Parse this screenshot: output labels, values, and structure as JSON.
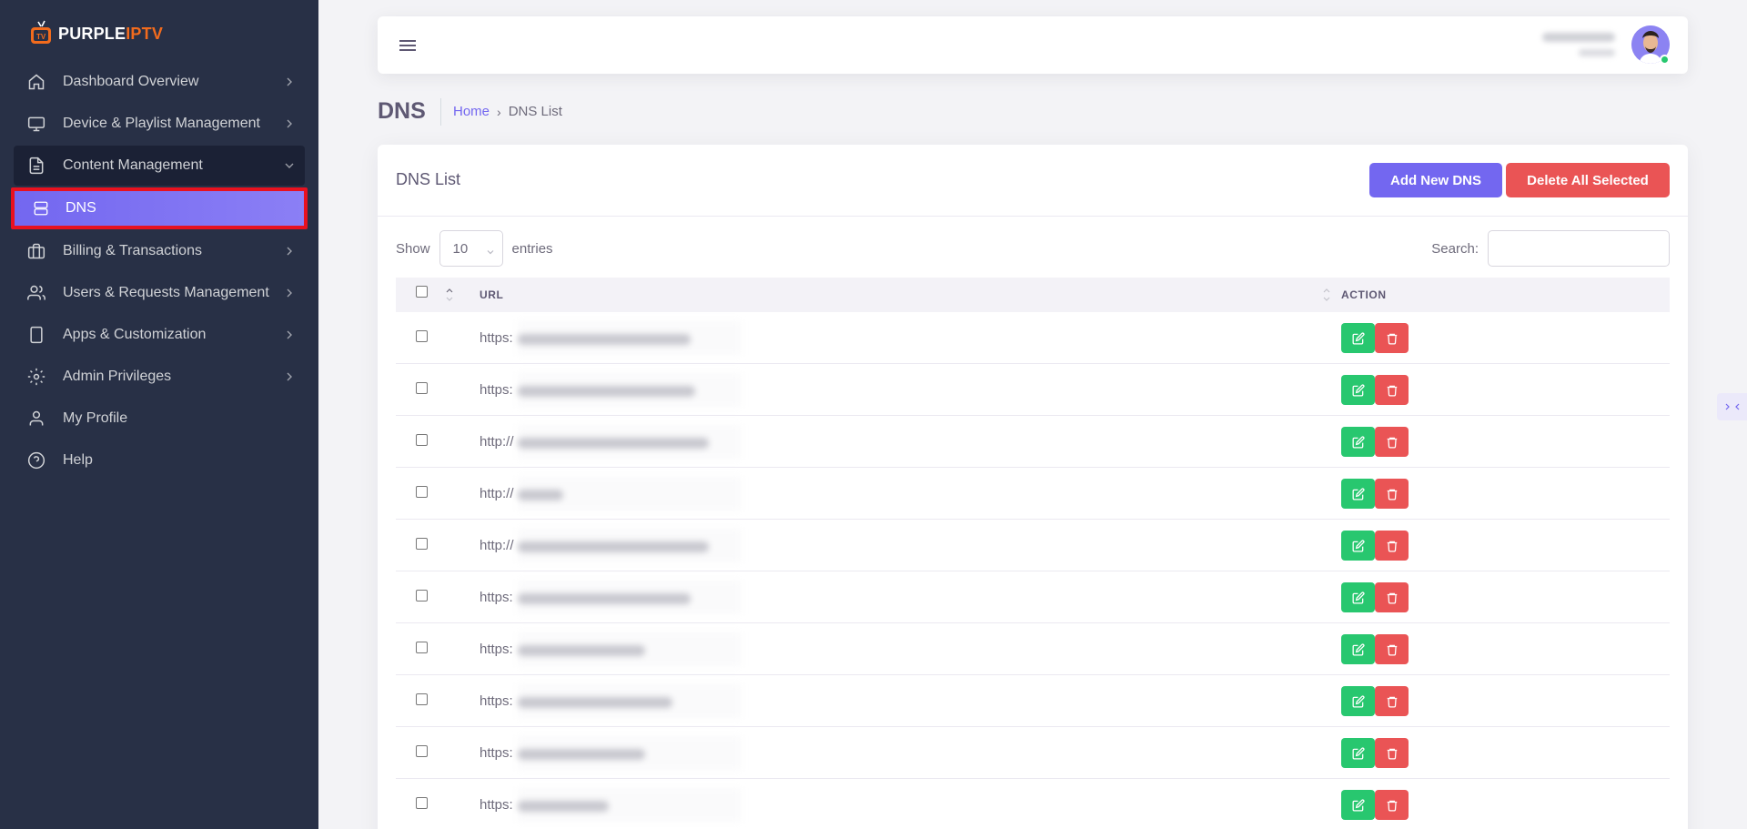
{
  "brand": {
    "name_part1": "PURPLE",
    "name_part2": "IPTV"
  },
  "sidebar": {
    "items": [
      {
        "label": "Dashboard Overview",
        "icon": "home-icon",
        "chevron": true
      },
      {
        "label": "Device & Playlist Management",
        "icon": "monitor-icon",
        "chevron": true
      },
      {
        "label": "Content Management",
        "icon": "file-icon",
        "chevron": true,
        "open": true
      },
      {
        "label": "DNS",
        "icon": "server-icon",
        "active": true
      },
      {
        "label": "Billing & Transactions",
        "icon": "briefcase-icon",
        "chevron": true
      },
      {
        "label": "Users & Requests Management",
        "icon": "users-icon",
        "chevron": true
      },
      {
        "label": "Apps & Customization",
        "icon": "tablet-icon",
        "chevron": true
      },
      {
        "label": "Admin Privileges",
        "icon": "gear-icon",
        "chevron": true
      },
      {
        "label": "My Profile",
        "icon": "user-icon"
      },
      {
        "label": "Help",
        "icon": "help-circle-icon"
      }
    ]
  },
  "page": {
    "title": "DNS",
    "breadcrumb": {
      "home": "Home",
      "separator": "›",
      "current": "DNS List"
    }
  },
  "card": {
    "title": "DNS List",
    "add_button": "Add New DNS",
    "delete_button": "Delete All Selected",
    "show_label": "Show",
    "page_length": "10",
    "entries_label": "entries",
    "search_label": "Search:",
    "search_value": ""
  },
  "table": {
    "columns": {
      "url": "URL",
      "action": "ACTION"
    },
    "rows": [
      {
        "url": "https:"
      },
      {
        "url": "https:"
      },
      {
        "url": "http://"
      },
      {
        "url": "http://"
      },
      {
        "url": "http://"
      },
      {
        "url": "https:"
      },
      {
        "url": "https:"
      },
      {
        "url": "https:"
      },
      {
        "url": "https:"
      },
      {
        "url": "https:"
      }
    ]
  },
  "colors": {
    "primary": "#7367f0",
    "success": "#28c76f",
    "danger": "#ea5455",
    "sidebar": "#283046"
  }
}
